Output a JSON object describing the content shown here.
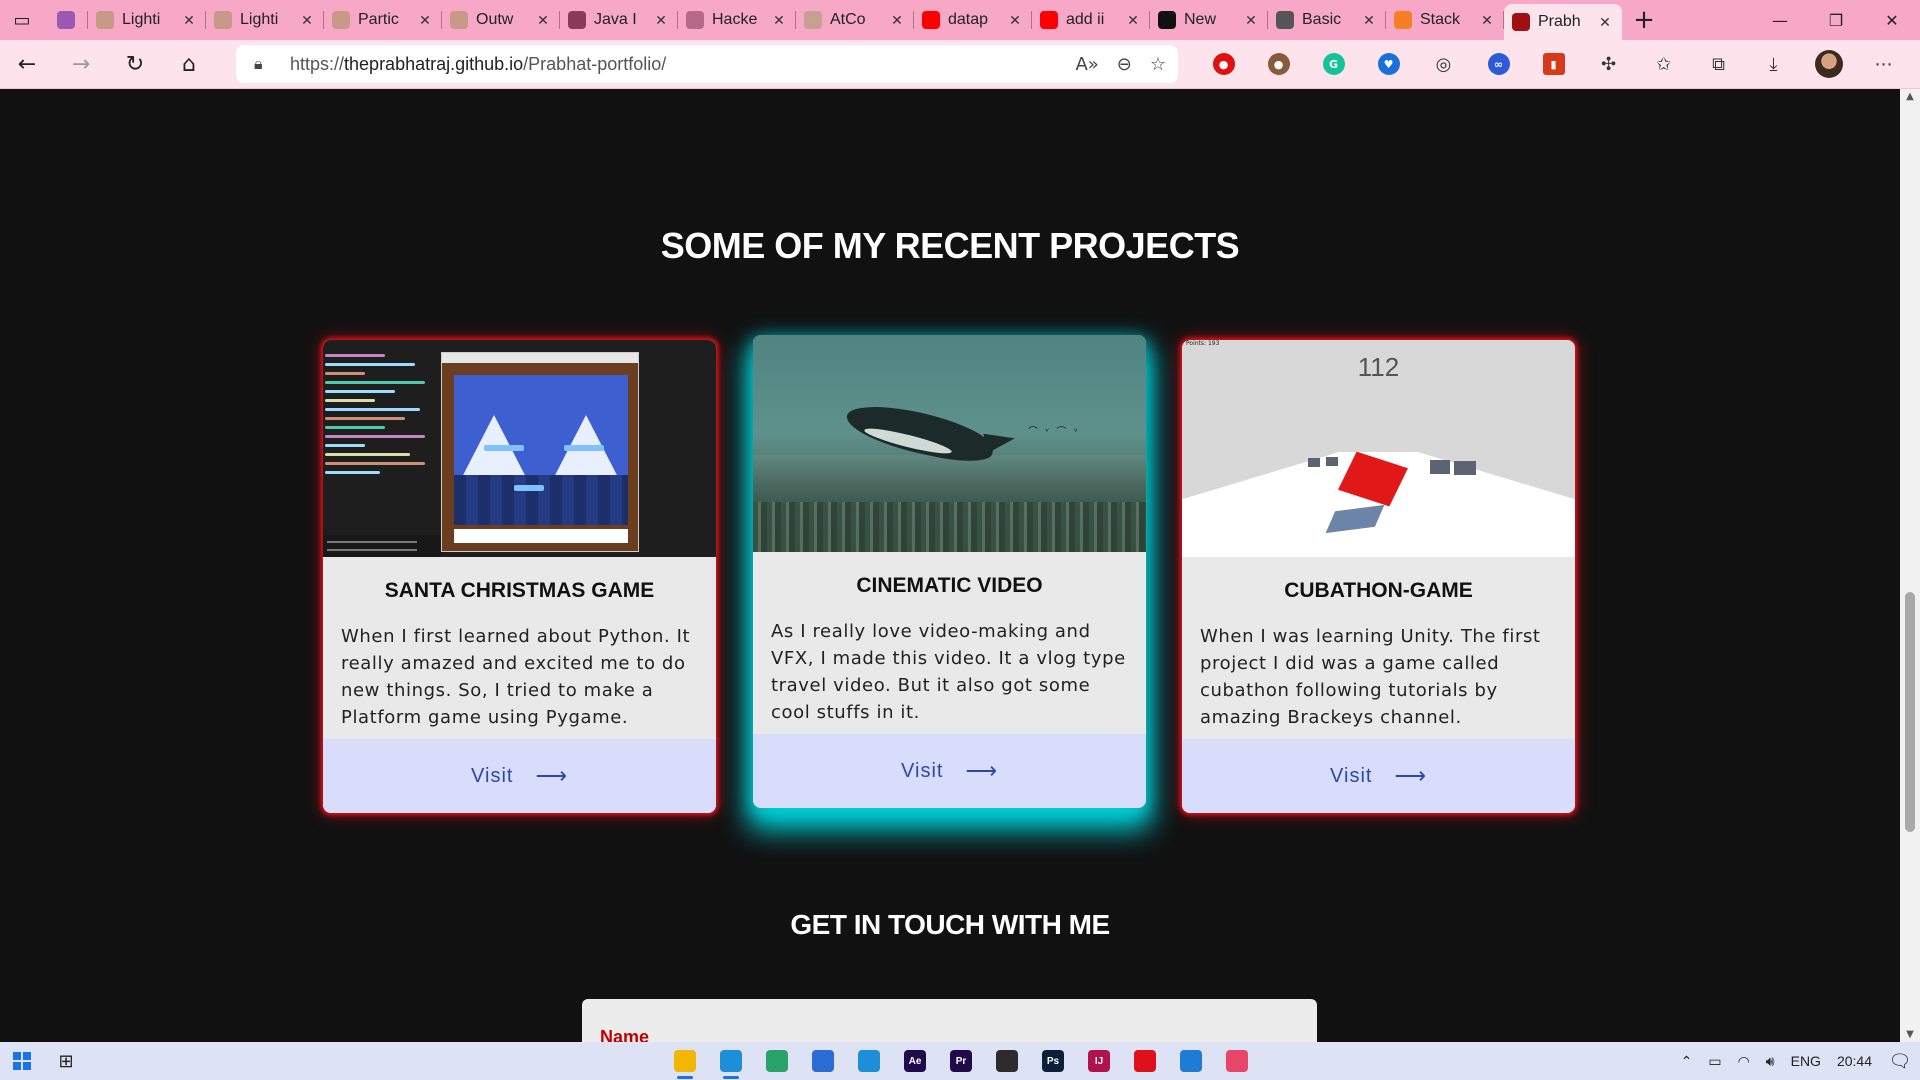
{
  "browser": {
    "tabs": [
      {
        "title": "",
        "icon": "heart-shield-icon",
        "color": "#9b59b6",
        "pinned": true
      },
      {
        "title": "Lighti",
        "icon": "page-icon",
        "color": "#c69a86"
      },
      {
        "title": "Lighti",
        "icon": "page-icon",
        "color": "#c69a86"
      },
      {
        "title": "Partic",
        "icon": "page-icon",
        "color": "#c69a86"
      },
      {
        "title": "Outw",
        "icon": "page-icon",
        "color": "#c69a86"
      },
      {
        "title": "Java I",
        "icon": "grid-icon",
        "color": "#8a3a5a"
      },
      {
        "title": "Hacke",
        "icon": "hacker-icon",
        "color": "#b56a8a"
      },
      {
        "title": "AtCo",
        "icon": "atcoder-icon",
        "color": "#c6a090"
      },
      {
        "title": "datap",
        "icon": "youtube-icon",
        "color": "#ff0000"
      },
      {
        "title": "add ii",
        "icon": "youtube-icon",
        "color": "#ff0000"
      },
      {
        "title": "New",
        "icon": "github-icon",
        "color": "#111111"
      },
      {
        "title": "Basic",
        "icon": "grid-icon",
        "color": "#555555"
      },
      {
        "title": "Stack",
        "icon": "stack-icon",
        "color": "#f48024"
      },
      {
        "title": "Prabh",
        "icon": "p-icon",
        "color": "#a01010",
        "active": true
      }
    ],
    "url_prefix": "https://",
    "url_host": "theprabhatraj.github.io",
    "url_path": "/Prabhat-portfolio/"
  },
  "page": {
    "projects_heading": "SOME OF MY RECENT PROJECTS",
    "contact_heading": "GET IN TOUCH WITH ME",
    "projects": [
      {
        "title": "SANTA CHRISTMAS GAME",
        "description": "When I first learned about Python. It really amazed and excited me to do new things. So, I tried to make a Platform game using Pygame.",
        "link_label": "Visit",
        "glow_color": "#e0101a"
      },
      {
        "title": "CINEMATIC VIDEO",
        "description": "As I really love video-making and VFX, I made this video. It a vlog type travel video. But it also got some cool stuffs in it.",
        "link_label": "Visit",
        "glow_color": "#00d0d8"
      },
      {
        "title": "CUBATHON-GAME",
        "description": "When I was learning Unity. The first project I did was a game called cubathon following tutorials by amazing Brackeys channel.",
        "link_label": "Visit",
        "glow_color": "#e0101a",
        "image_score": "112",
        "image_score_small": "Points: 193"
      }
    ],
    "form": {
      "name_label": "Name"
    }
  },
  "taskbar": {
    "apps": [
      {
        "icon": "file-explorer-icon",
        "label": "",
        "color": "#f2b705",
        "open": true
      },
      {
        "icon": "edge-icon",
        "label": "",
        "color": "#1d8fd8",
        "open": true
      },
      {
        "icon": "edge-beta-icon",
        "label": "",
        "color": "#2aa36b"
      },
      {
        "icon": "pen-icon",
        "label": "",
        "color": "#2b6cd4"
      },
      {
        "icon": "edge-dev-icon",
        "label": "",
        "color": "#1d8fd8"
      },
      {
        "icon": "after-effects-icon",
        "label": "Ae",
        "color": "#1f0a4a"
      },
      {
        "icon": "premiere-icon",
        "label": "Pr",
        "color": "#1f0a4a"
      },
      {
        "icon": "obs-icon",
        "label": "",
        "color": "#2c2c2c"
      },
      {
        "icon": "photoshop-icon",
        "label": "Ps",
        "color": "#0b1f3a"
      },
      {
        "icon": "intellij-icon",
        "label": "IJ",
        "color": "#b0124d"
      },
      {
        "icon": "opera-icon",
        "label": "",
        "color": "#e0101a"
      },
      {
        "icon": "vscode-icon",
        "label": "",
        "color": "#1e7bd6"
      },
      {
        "icon": "app-icon",
        "label": "",
        "color": "#e8456b"
      }
    ],
    "language": "ENG",
    "time": "20:44"
  }
}
